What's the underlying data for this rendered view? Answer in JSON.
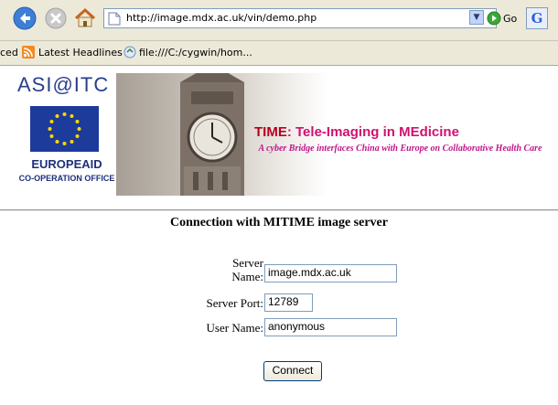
{
  "browser": {
    "url": "http://image.mdx.ac.uk/vin/demo.php",
    "go_label": "Go",
    "search_icon_letter": "G",
    "icons": [
      "back-icon",
      "stop-icon",
      "home-icon",
      "page-icon",
      "dropdown-icon",
      "go-icon",
      "google-toolbar-icon"
    ]
  },
  "bookmarks": {
    "items": [
      {
        "label": "ced",
        "icon": "none"
      },
      {
        "label": "Latest Headlines",
        "icon": "rss-icon"
      },
      {
        "label": "file:///C:/cygwin/hom...",
        "icon": "file-icon"
      }
    ]
  },
  "banner": {
    "logo_text": "ASI@ITC",
    "europeaid": "EUROPEAID",
    "coop_office": "CO-OPERATION OFFICE",
    "title_time": "TIME",
    "title_rest": ": Tele-Imaging in MEdicine",
    "subtitle": "A cyber Bridge interfaces China with Europe on Collaborative Health Care",
    "colors": {
      "title": "#d1116f",
      "eu_blue": "#1d3b9a",
      "star": "#ffd700"
    }
  },
  "form": {
    "heading": "Connection with MITIME image server",
    "server_name_label": "Server Name:",
    "server_name_value": "image.mdx.ac.uk",
    "server_port_label": "Server Port:",
    "server_port_value": "12789",
    "user_name_label": "User Name:",
    "user_name_value": "anonymous",
    "connect_label": "Connect"
  }
}
